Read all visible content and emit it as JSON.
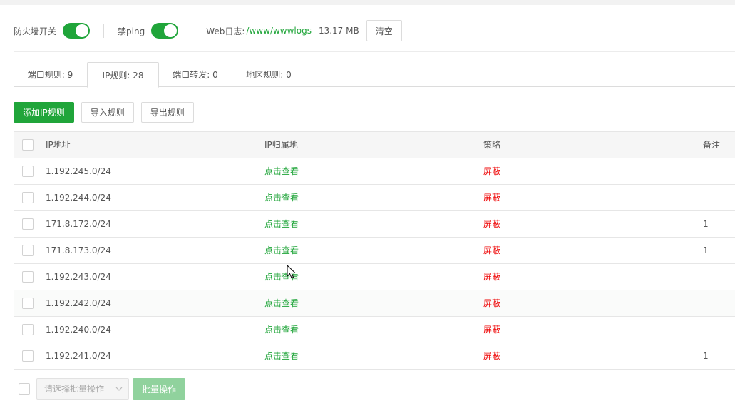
{
  "topbar": {
    "firewall_label": "防火墙开关",
    "firewall_on": true,
    "ping_label": "禁ping",
    "ping_on": true,
    "weblog_label": "Web日志:",
    "weblog_path": "/www/wwwlogs",
    "weblog_size": "13.17 MB",
    "clear_label": "清空"
  },
  "tabs": [
    {
      "label": "端口规则: 9",
      "active": false
    },
    {
      "label": "IP规则: 28",
      "active": true
    },
    {
      "label": "端口转发: 0",
      "active": false
    },
    {
      "label": "地区规则: 0",
      "active": false
    }
  ],
  "actions": {
    "add_label": "添加IP规则",
    "import_label": "导入规则",
    "export_label": "导出规则"
  },
  "table": {
    "headers": {
      "ip": "IP地址",
      "location": "IP归属地",
      "policy": "策略",
      "note": "备注"
    },
    "rows": [
      {
        "ip": "1.192.245.0/24",
        "location": "点击查看",
        "policy": "屏蔽",
        "note": ""
      },
      {
        "ip": "1.192.244.0/24",
        "location": "点击查看",
        "policy": "屏蔽",
        "note": ""
      },
      {
        "ip": "171.8.172.0/24",
        "location": "点击查看",
        "policy": "屏蔽",
        "note": "1"
      },
      {
        "ip": "171.8.173.0/24",
        "location": "点击查看",
        "policy": "屏蔽",
        "note": "1"
      },
      {
        "ip": "1.192.243.0/24",
        "location": "点击查看",
        "policy": "屏蔽",
        "note": ""
      },
      {
        "ip": "1.192.242.0/24",
        "location": "点击查看",
        "policy": "屏蔽",
        "note": ""
      },
      {
        "ip": "1.192.240.0/24",
        "location": "点击查看",
        "policy": "屏蔽",
        "note": ""
      },
      {
        "ip": "1.192.241.0/24",
        "location": "点击查看",
        "policy": "屏蔽",
        "note": "1"
      }
    ]
  },
  "batch": {
    "select_placeholder": "请选择批量操作",
    "button_label": "批量操作"
  },
  "colors": {
    "accent": "#20a53a",
    "danger": "#ef0808"
  }
}
